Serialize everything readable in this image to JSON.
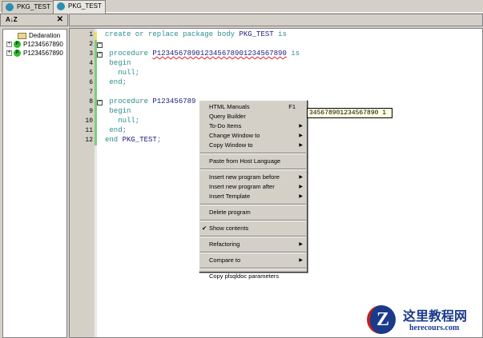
{
  "tabs": [
    {
      "label": "PKG_TEST"
    },
    {
      "label": "PKG_TEST"
    }
  ],
  "left_panel": {
    "sort_label": "A↓Z",
    "close_label": "✕",
    "tree": [
      {
        "label": "Dedaration",
        "icon": "folder-icon"
      },
      {
        "label": "P1234567890",
        "icon": "procedure-icon",
        "badge": "P"
      },
      {
        "label": "P1234567890",
        "icon": "procedure-icon",
        "badge": "P"
      }
    ]
  },
  "editor": {
    "line_numbers": [
      "1",
      "2",
      "3",
      "4",
      "5",
      "6",
      "7",
      "8",
      "9",
      "10",
      "11",
      "12"
    ],
    "lines": [
      {
        "kw": "create or replace package body ",
        "id": "PKG_TEST",
        "rest": " is"
      },
      {
        "kw": "",
        "id": "",
        "rest": ""
      },
      {
        "kw": " procedure ",
        "id": "P123456789012345678901234567890",
        "rest": " is"
      },
      {
        "kw": " begin",
        "id": "",
        "rest": ""
      },
      {
        "kw": "   null;",
        "id": "",
        "rest": ""
      },
      {
        "kw": " end;",
        "id": "",
        "rest": ""
      },
      {
        "kw": "",
        "id": "",
        "rest": ""
      },
      {
        "kw": " procedure ",
        "id": "P123456789",
        "rest": ""
      },
      {
        "kw": " begin",
        "id": "",
        "rest": ""
      },
      {
        "kw": "   null;",
        "id": "",
        "rest": ""
      },
      {
        "kw": " end;",
        "id": "",
        "rest": ""
      },
      {
        "kw": "end ",
        "id": "PKG_TEST",
        "rest": ";"
      }
    ]
  },
  "tooltip": "345678901234567890 1",
  "context_menu": [
    {
      "label": "HTML Manuals",
      "shortcut": "F1"
    },
    {
      "label": "Query Builder"
    },
    {
      "label": "To-Do Items",
      "submenu": true
    },
    {
      "label": "Change Window to",
      "submenu": true
    },
    {
      "label": "Copy Window to",
      "submenu": true
    },
    {
      "sep": true
    },
    {
      "label": "Paste from Host Language"
    },
    {
      "sep": true
    },
    {
      "label": "Insert new program before",
      "submenu": true
    },
    {
      "label": "Insert new program after",
      "submenu": true
    },
    {
      "label": "Insert Template",
      "submenu": true
    },
    {
      "sep": true
    },
    {
      "label": "Delete program"
    },
    {
      "sep": true
    },
    {
      "label": "Show contents",
      "checked": true
    },
    {
      "sep": true
    },
    {
      "label": "Refactoring",
      "submenu": true
    },
    {
      "sep": true
    },
    {
      "label": "Compare to",
      "submenu": true
    },
    {
      "sep": true
    },
    {
      "label": "Copy plsqldoc parameters"
    }
  ],
  "watermark": {
    "title": "这里教程网",
    "url": "herecours.com",
    "letter": "Z"
  }
}
